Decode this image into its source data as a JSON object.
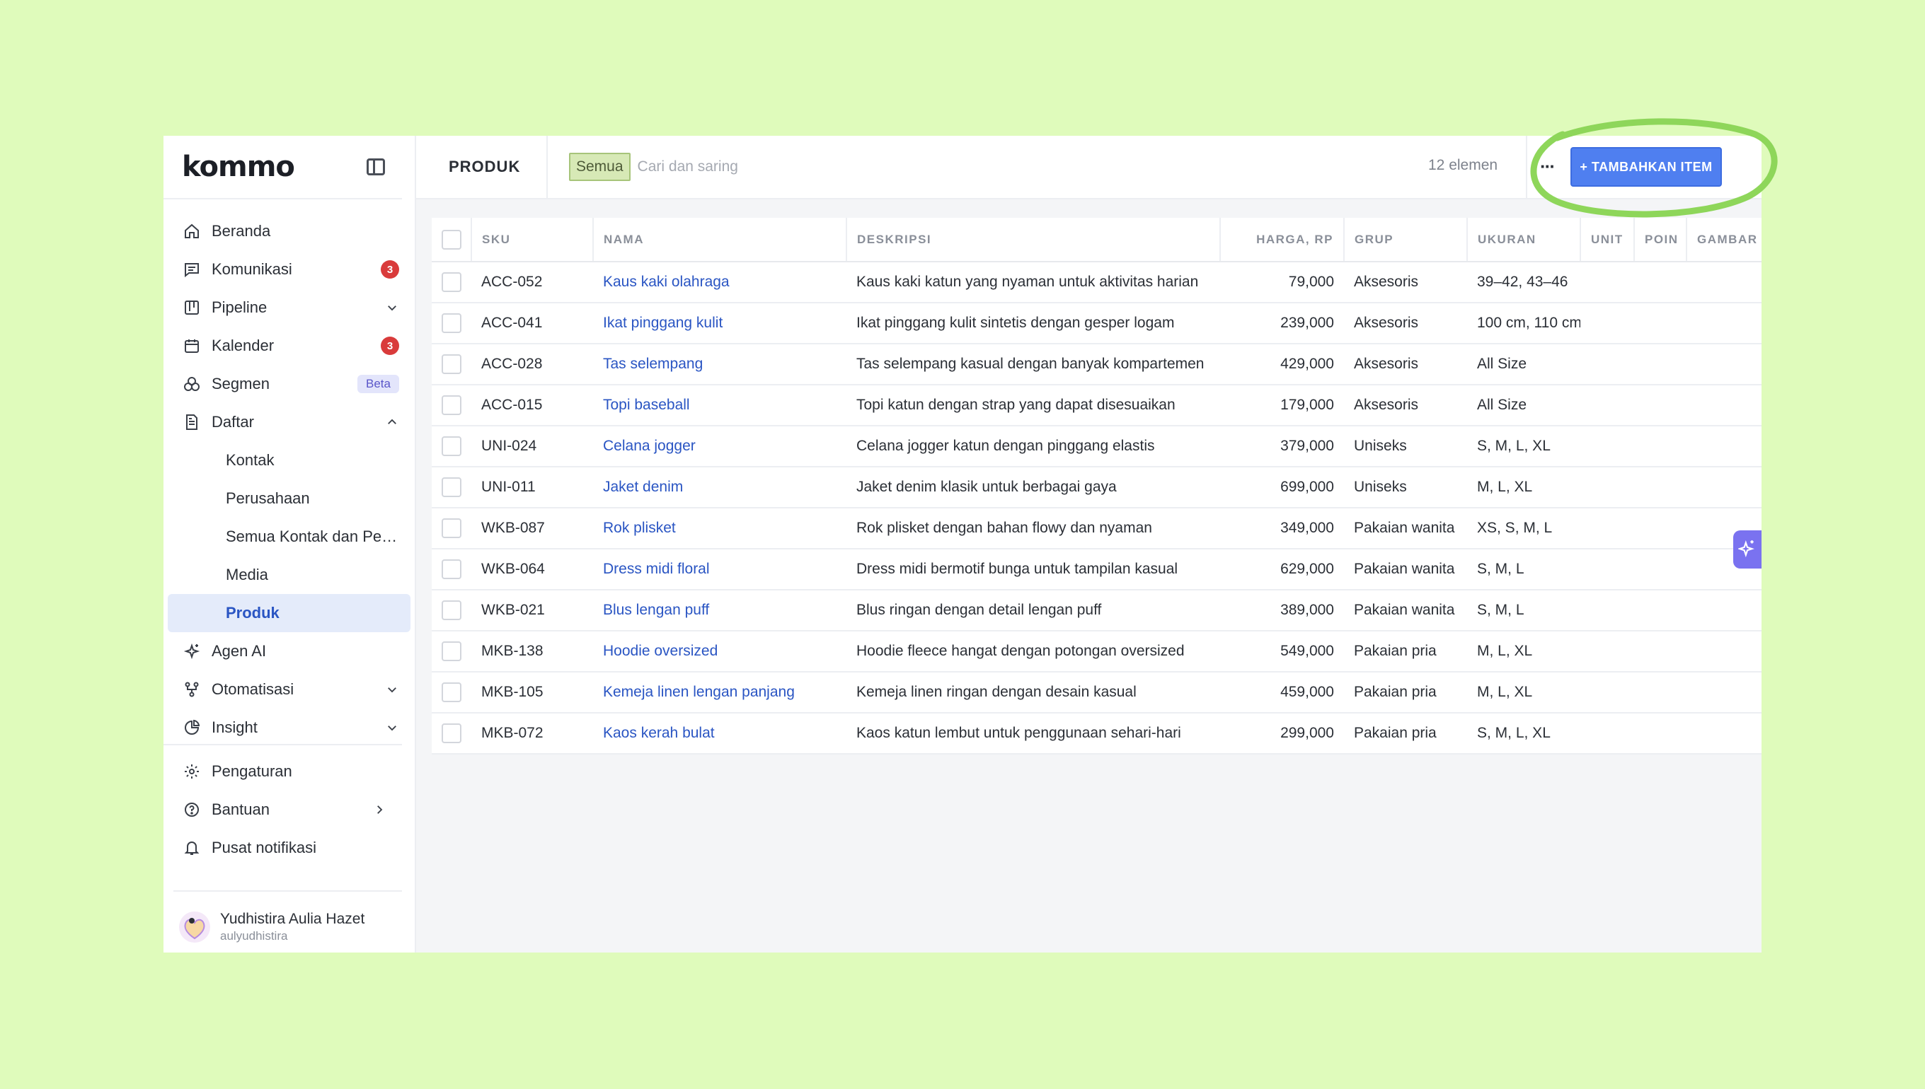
{
  "brand": {
    "logo_text": "kommo"
  },
  "sidebar": {
    "items": [
      {
        "label": "Beranda"
      },
      {
        "label": "Komunikasi",
        "badge": "3"
      },
      {
        "label": "Pipeline"
      },
      {
        "label": "Kalender",
        "badge": "3"
      },
      {
        "label": "Segmen",
        "tag": "Beta"
      },
      {
        "label": "Daftar"
      },
      {
        "label": "Kontak"
      },
      {
        "label": "Perusahaan"
      },
      {
        "label": "Semua Kontak dan Peru..."
      },
      {
        "label": "Media"
      },
      {
        "label": "Produk"
      },
      {
        "label": "Agen AI"
      },
      {
        "label": "Otomatisasi"
      },
      {
        "label": "Insight"
      }
    ],
    "bottom": [
      {
        "label": "Pengaturan"
      },
      {
        "label": "Bantuan"
      },
      {
        "label": "Pusat notifikasi"
      }
    ],
    "user": {
      "name": "Yudhistira Aulia Hazet",
      "handle": "aulyudhistira"
    }
  },
  "header": {
    "title": "PRODUK",
    "filter_chip": "Semua",
    "search_placeholder": "Cari dan saring",
    "count": "12 elemen",
    "more": "···",
    "add_button": "+ TAMBAHKAN ITEM"
  },
  "table": {
    "columns": [
      "SKU",
      "NAMA",
      "DESKRIPSI",
      "HARGA, RP",
      "GRUP",
      "UKURAN",
      "UNIT",
      "POIN",
      "GAMBAR"
    ],
    "rows": [
      [
        "ACC-052",
        "Kaus kaki olahraga",
        "Kaus kaki katun yang nyaman untuk aktivitas harian",
        "79,000",
        "Aksesoris",
        "39–42, 43–46"
      ],
      [
        "ACC-041",
        "Ikat pinggang kulit",
        "Ikat pinggang kulit sintetis dengan gesper logam",
        "239,000",
        "Aksesoris",
        "100 cm, 110 cm"
      ],
      [
        "ACC-028",
        "Tas selempang",
        "Tas selempang kasual dengan banyak kompartemen",
        "429,000",
        "Aksesoris",
        "All Size"
      ],
      [
        "ACC-015",
        "Topi baseball",
        "Topi katun dengan strap yang dapat disesuaikan",
        "179,000",
        "Aksesoris",
        "All Size"
      ],
      [
        "UNI-024",
        "Celana jogger",
        "Celana jogger katun dengan pinggang elastis",
        "379,000",
        "Uniseks",
        "S, M, L, XL"
      ],
      [
        "UNI-011",
        "Jaket denim",
        "Jaket denim klasik untuk berbagai gaya",
        "699,000",
        "Uniseks",
        "M, L, XL"
      ],
      [
        "WKB-087",
        "Rok plisket",
        "Rok plisket dengan bahan flowy dan nyaman",
        "349,000",
        "Pakaian wanita",
        "XS, S, M, L"
      ],
      [
        "WKB-064",
        "Dress midi floral",
        "Dress midi bermotif bunga untuk tampilan kasual",
        "629,000",
        "Pakaian wanita",
        "S, M, L"
      ],
      [
        "WKB-021",
        "Blus lengan puff",
        "Blus ringan dengan detail lengan puff",
        "389,000",
        "Pakaian wanita",
        "S, M, L"
      ],
      [
        "MKB-138",
        "Hoodie oversized",
        "Hoodie fleece hangat dengan potongan oversized",
        "549,000",
        "Pakaian pria",
        "M, L, XL"
      ],
      [
        "MKB-105",
        "Kemeja linen lengan panjang",
        "Kemeja linen ringan dengan desain kasual",
        "459,000",
        "Pakaian pria",
        "M, L, XL"
      ],
      [
        "MKB-072",
        "Kaos kerah bulat",
        "Kaos katun lembut untuk penggunaan sehari-hari",
        "299,000",
        "Pakaian pria",
        "S, M, L, XL"
      ]
    ]
  },
  "colors": {
    "page_bg": "#dffbbb",
    "accent": "#4f7ff0",
    "link": "#2a55c3",
    "badge": "#d93b3b",
    "annotation": "#8ed65a"
  }
}
